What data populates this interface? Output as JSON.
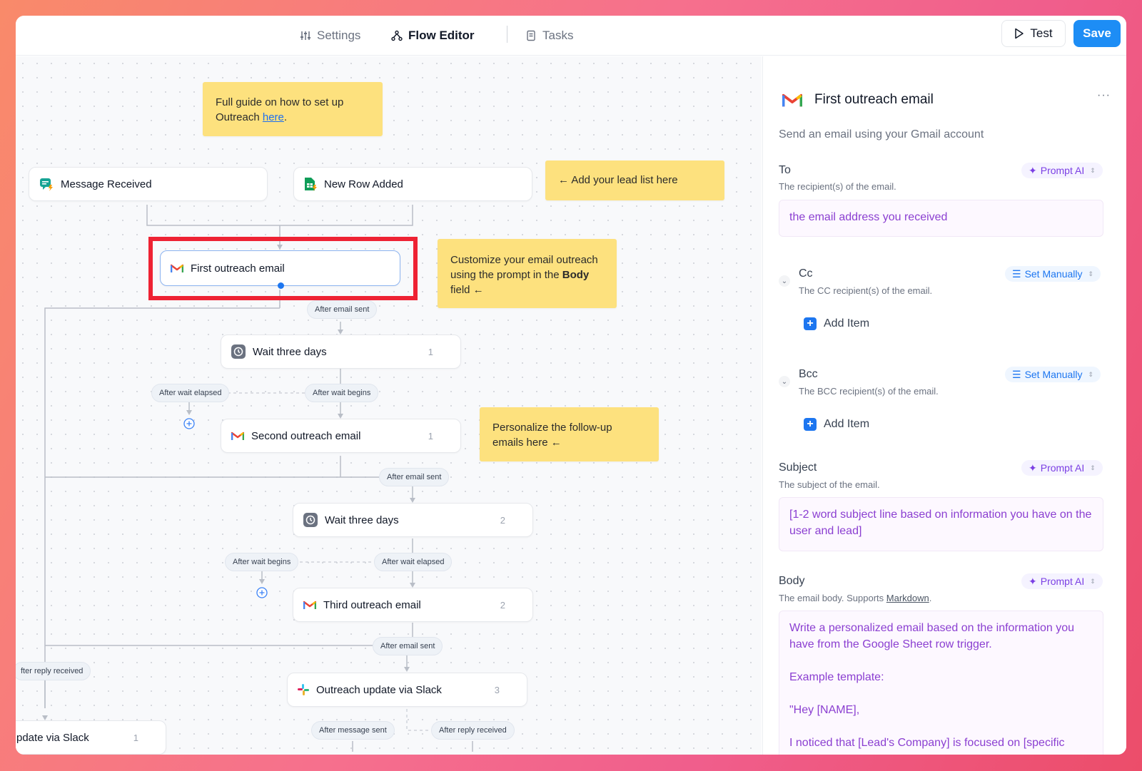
{
  "nav": {
    "settings": "Settings",
    "flow_editor": "Flow Editor",
    "tasks": "Tasks",
    "test": "Test",
    "save": "Save"
  },
  "canvas": {
    "notes": {
      "guide_prefix": "Full guide on how to set up Outreach ",
      "guide_link": "here",
      "guide_suffix": ".",
      "lead_list": "← Add your lead list here",
      "customize_prefix": "Customize your email outreach using the prompt in the ",
      "customize_bold": "Body",
      "customize_suffix": " field ←",
      "personalize": "Personalize the follow-up emails here ←"
    },
    "nodes": {
      "message_received": "Message Received",
      "new_row_added": "New Row Added",
      "first_email": "First outreach email",
      "wait1": "Wait three days",
      "wait1_count": "1",
      "second_email": "Second outreach email",
      "second_email_count": "1",
      "wait2": "Wait three days",
      "wait2_count": "2",
      "third_email": "Third outreach email",
      "third_email_count": "2",
      "slack": "Outreach update via Slack",
      "slack_count": "3",
      "slack_left": "pdate via Slack",
      "slack_left_count": "1"
    },
    "pills": {
      "after_email_sent_1": "After email sent",
      "after_wait_elapsed_1": "After wait elapsed",
      "after_wait_begins_1": "After wait begins",
      "after_email_sent_2": "After email sent",
      "after_wait_begins_2": "After wait begins",
      "after_wait_elapsed_2": "After wait elapsed",
      "after_email_sent_3": "After email sent",
      "after_reply_received_left": "fter reply received",
      "after_message_sent": "After message sent",
      "after_reply_received": "After reply received"
    }
  },
  "panel": {
    "title": "First outreach email",
    "subtitle": "Send an email using your Gmail account",
    "to": {
      "label": "To",
      "desc": "The recipient(s) of the email.",
      "mode": "Prompt AI",
      "value": "the email address you received"
    },
    "cc": {
      "label": "Cc",
      "desc": "The CC recipient(s) of the email.",
      "mode": "Set Manually",
      "add": "Add Item"
    },
    "bcc": {
      "label": "Bcc",
      "desc": "The BCC recipient(s) of the email.",
      "mode": "Set Manually",
      "add": "Add Item"
    },
    "subject": {
      "label": "Subject",
      "desc": "The subject of the email.",
      "mode": "Prompt AI",
      "value": "[1-2 word subject line based on information you have on the user and lead]"
    },
    "body": {
      "label": "Body",
      "desc_prefix": "The email body. Supports ",
      "desc_link": "Markdown",
      "desc_suffix": ".",
      "mode": "Prompt AI",
      "line1": "Write a personalized email based on the information you have from the Google Sheet row trigger.",
      "line2": "Example template:",
      "line3": "\"Hey [NAME],",
      "line4": "I noticed that [Lead's Company] is focused on [specific"
    }
  }
}
